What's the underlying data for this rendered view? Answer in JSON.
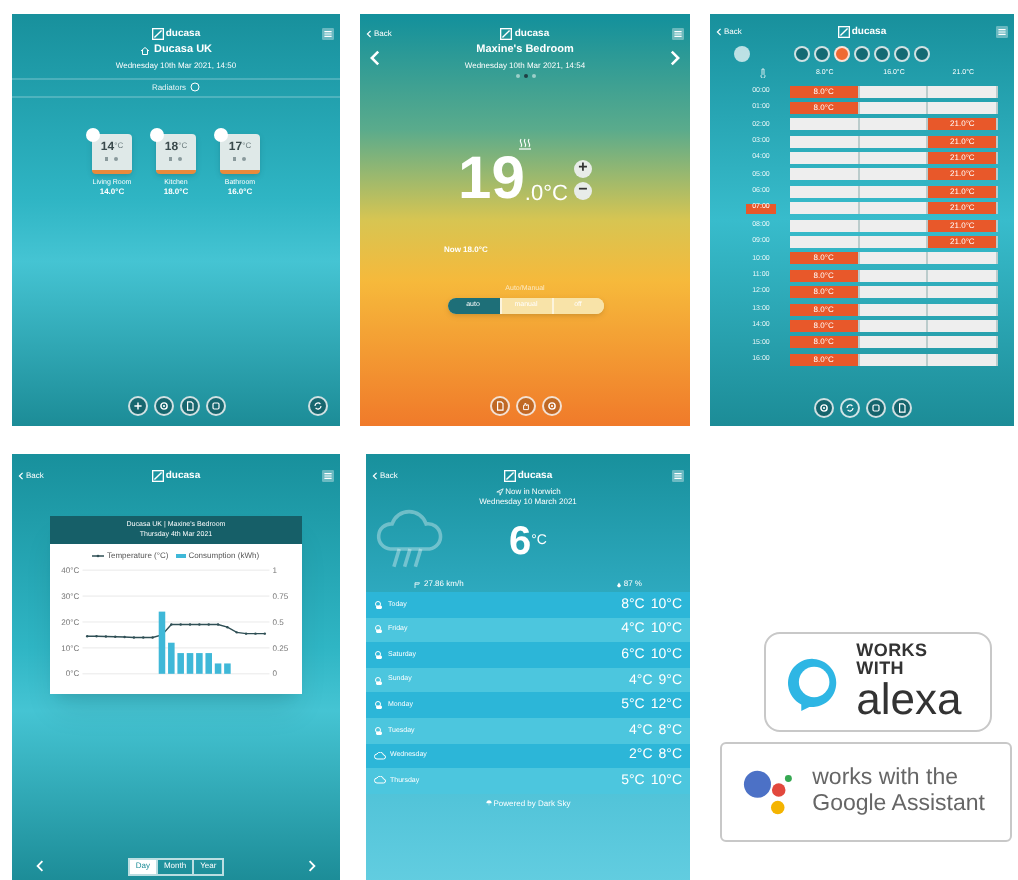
{
  "home": {
    "logo": "ducasa",
    "location": "Ducasa UK",
    "date": "Wednesday 10th Mar 2021, 14:50",
    "section": "Radiators",
    "radiators": [
      {
        "temp": "14",
        "unit": "°C",
        "name": "Living Room",
        "reading": "14.0°C"
      },
      {
        "temp": "18",
        "unit": "°C",
        "name": "Kitchen",
        "reading": "18.0°C"
      },
      {
        "temp": "17",
        "unit": "°C",
        "name": "Bathroom",
        "reading": "16.0°C"
      }
    ]
  },
  "room": {
    "back": "Back",
    "logo": "ducasa",
    "name": "Maxine's Bedroom",
    "date": "Wednesday 10th Mar 2021, 14:54",
    "pages": [
      {
        "selected": false
      },
      {
        "selected": true
      },
      {
        "selected": false
      }
    ],
    "setpoint": "19",
    "decimal": ".0°C",
    "plus": "+",
    "minus": "−",
    "now": "Now 18.0°C",
    "mode_label": "Auto/Manual",
    "modes": [
      {
        "label": "auto",
        "selected": true
      },
      {
        "label": "manual",
        "selected": false
      },
      {
        "label": "off",
        "selected": false
      }
    ]
  },
  "schedule": {
    "back": "Back",
    "logo": "ducasa",
    "days": [
      {
        "selected": false
      },
      {
        "selected": false
      },
      {
        "selected": true
      },
      {
        "selected": false
      },
      {
        "selected": false
      },
      {
        "selected": false
      },
      {
        "selected": false
      }
    ],
    "levels": [
      "8.0°C",
      "16.0°C",
      "21.0°C"
    ],
    "rows": [
      {
        "time": "00:00",
        "selected": false,
        "cells": [
          {
            "on": true,
            "label": "8.0°C"
          },
          {
            "on": false
          },
          {
            "on": false
          }
        ]
      },
      {
        "time": "01:00",
        "selected": false,
        "cells": [
          {
            "on": true,
            "label": "8.0°C"
          },
          {
            "on": false
          },
          {
            "on": false
          }
        ]
      },
      {
        "time": "02:00",
        "selected": false,
        "cells": [
          {
            "on": false
          },
          {
            "on": false
          },
          {
            "on": true,
            "label": "21.0°C"
          }
        ]
      },
      {
        "time": "03:00",
        "selected": false,
        "cells": [
          {
            "on": false
          },
          {
            "on": false
          },
          {
            "on": true,
            "label": "21.0°C"
          }
        ]
      },
      {
        "time": "04:00",
        "selected": false,
        "cells": [
          {
            "on": false
          },
          {
            "on": false
          },
          {
            "on": true,
            "label": "21.0°C"
          }
        ]
      },
      {
        "time": "05:00",
        "selected": false,
        "cells": [
          {
            "on": false
          },
          {
            "on": false
          },
          {
            "on": true,
            "label": "21.0°C"
          }
        ]
      },
      {
        "time": "06:00",
        "selected": false,
        "cells": [
          {
            "on": false
          },
          {
            "on": false
          },
          {
            "on": true,
            "label": "21.0°C"
          }
        ]
      },
      {
        "time": "07:00",
        "selected": true,
        "cells": [
          {
            "on": false
          },
          {
            "on": false
          },
          {
            "on": true,
            "label": "21.0°C"
          }
        ]
      },
      {
        "time": "08:00",
        "selected": false,
        "cells": [
          {
            "on": false
          },
          {
            "on": false
          },
          {
            "on": true,
            "label": "21.0°C"
          }
        ]
      },
      {
        "time": "09:00",
        "selected": false,
        "cells": [
          {
            "on": false
          },
          {
            "on": false
          },
          {
            "on": true,
            "label": "21.0°C"
          }
        ]
      },
      {
        "time": "10:00",
        "selected": false,
        "cells": [
          {
            "on": true,
            "label": "8.0°C"
          },
          {
            "on": false
          },
          {
            "on": false
          }
        ]
      },
      {
        "time": "11:00",
        "selected": false,
        "cells": [
          {
            "on": true,
            "label": "8.0°C"
          },
          {
            "on": false
          },
          {
            "on": false
          }
        ]
      },
      {
        "time": "12:00",
        "selected": false,
        "cells": [
          {
            "on": true,
            "label": "8.0°C"
          },
          {
            "on": false
          },
          {
            "on": false
          }
        ]
      },
      {
        "time": "13:00",
        "selected": false,
        "cells": [
          {
            "on": true,
            "label": "8.0°C"
          },
          {
            "on": false
          },
          {
            "on": false
          }
        ]
      },
      {
        "time": "14:00",
        "selected": false,
        "cells": [
          {
            "on": true,
            "label": "8.0°C"
          },
          {
            "on": false
          },
          {
            "on": false
          }
        ]
      },
      {
        "time": "15:00",
        "selected": false,
        "cells": [
          {
            "on": true,
            "label": "8.0°C"
          },
          {
            "on": false
          },
          {
            "on": false
          }
        ]
      },
      {
        "time": "16:00",
        "selected": false,
        "cells": [
          {
            "on": true,
            "label": "8.0°C"
          },
          {
            "on": false
          },
          {
            "on": false
          }
        ]
      }
    ]
  },
  "history": {
    "back": "Back",
    "logo": "ducasa",
    "title": "Ducasa UK | Maxine's Bedroom",
    "subtitle": "Thursday 4th Mar 2021",
    "chart_data": {
      "type": "line",
      "grid": true,
      "ylim": [
        0,
        40
      ],
      "yticks": [
        {
          "value": 0,
          "label": "0°C"
        },
        {
          "value": 10,
          "label": "10°C"
        },
        {
          "value": 20,
          "label": "20°C"
        },
        {
          "value": 30,
          "label": "30°C"
        },
        {
          "value": 40,
          "label": "40°C"
        }
      ],
      "y2ticks": [
        "0",
        "0.25",
        "0.5",
        "0.75",
        "1"
      ],
      "series": [
        {
          "name": "Temperature (°C)",
          "color": "#2f4f55",
          "type": "line",
          "values": [
            14.5,
            14.5,
            14.4,
            14.3,
            14.2,
            14,
            14,
            14,
            15,
            19,
            19,
            19,
            19,
            19,
            19,
            18,
            16,
            15.5,
            15.5,
            15.5
          ]
        },
        {
          "name": "Consumption (kWh)",
          "color": "#3fb8d8",
          "type": "bar",
          "values": [
            0,
            0,
            0,
            0,
            0,
            0,
            0,
            0,
            0.6,
            0.3,
            0.2,
            0.2,
            0.2,
            0.2,
            0.1,
            0.1,
            0,
            0,
            0,
            0
          ]
        }
      ]
    },
    "ranges": [
      {
        "label": "Day",
        "selected": true
      },
      {
        "label": "Month",
        "selected": false
      },
      {
        "label": "Year",
        "selected": false
      }
    ]
  },
  "weather": {
    "back": "Back",
    "logo": "ducasa",
    "place": "Now in Norwich",
    "date": "Wednesday 10 March 2021",
    "temp": "6",
    "unit": "°C",
    "wind": "27.86 km/h",
    "humidity": "87 %",
    "days": [
      {
        "day": "Today",
        "low": "8°C",
        "high": "10°C",
        "kind": "partly"
      },
      {
        "day": "Friday",
        "low": "4°C",
        "high": "10°C",
        "kind": "partly"
      },
      {
        "day": "Saturday",
        "low": "6°C",
        "high": "10°C",
        "kind": "partly"
      },
      {
        "day": "Sunday",
        "low": "4°C",
        "high": "9°C",
        "kind": "partly"
      },
      {
        "day": "Monday",
        "low": "5°C",
        "high": "12°C",
        "kind": "partly"
      },
      {
        "day": "Tuesday",
        "low": "4°C",
        "high": "8°C",
        "kind": "partly"
      },
      {
        "day": "Wednesday",
        "low": "2°C",
        "high": "8°C",
        "kind": "cloudy"
      },
      {
        "day": "Thursday",
        "low": "5°C",
        "high": "10°C",
        "kind": "cloudy"
      }
    ],
    "credit": "Powered by Dark Sky"
  },
  "badges": {
    "alexa": {
      "caption": "WORKS WITH",
      "name": "alexa"
    },
    "google": {
      "caption": "works with the Google Assistant"
    }
  }
}
